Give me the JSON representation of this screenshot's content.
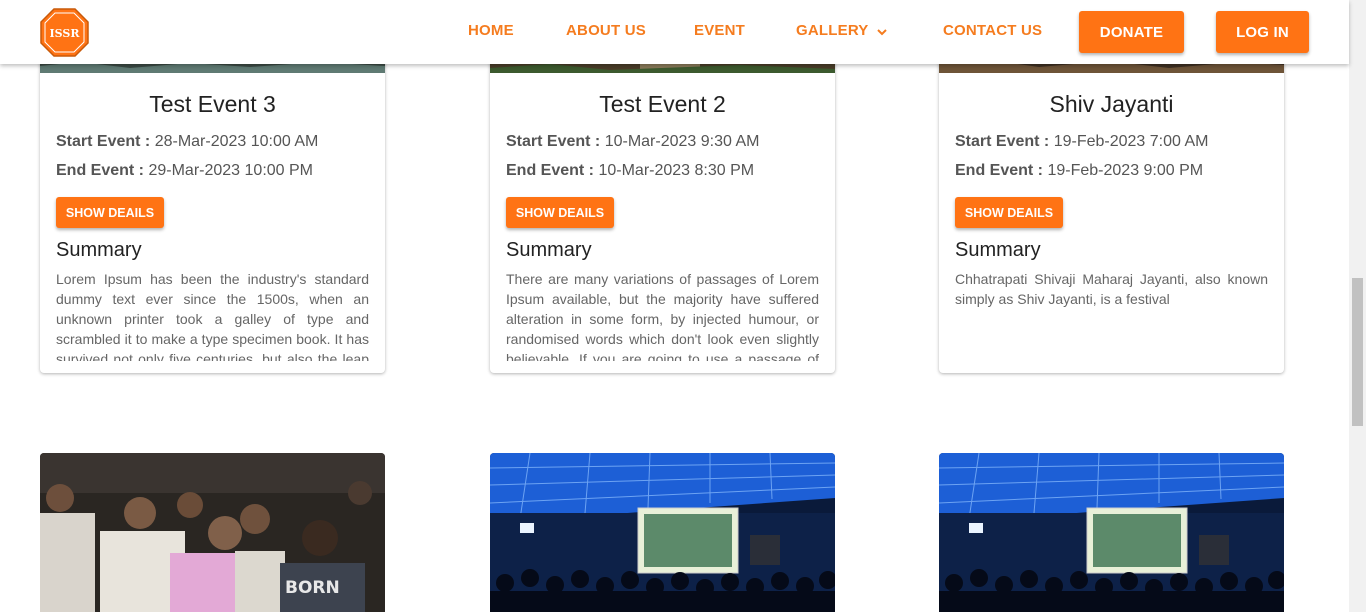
{
  "header": {
    "logo_text": "ISSR",
    "nav": [
      {
        "label": "HOME"
      },
      {
        "label": "ABOUT US"
      },
      {
        "label": "EVENT"
      },
      {
        "label": "GALLERY"
      },
      {
        "label": "CONTACT US"
      }
    ],
    "donate_label": "DONATE",
    "login_label": "LOG IN"
  },
  "colors": {
    "accent": "#ff7314",
    "nav": "#f57c1f"
  },
  "events": [
    {
      "title": "Test Event 3",
      "start_label": "Start Event :",
      "start": "28-Mar-2023 10:00 AM",
      "end_label": "End Event :",
      "end": "29-Mar-2023 10:00 PM",
      "button": "SHOW DEAILS",
      "summary_heading": "Summary",
      "summary": "Lorem Ipsum has been the industry's standard dummy text ever since the 1500s, when an unknown printer took a galley of type and scrambled it to make a type specimen book. It has survived not only five centuries, but also the leap into electronic typesetting"
    },
    {
      "title": "Test Event 2",
      "start_label": "Start Event :",
      "start": "10-Mar-2023 9:30 AM",
      "end_label": "End Event :",
      "end": "10-Mar-2023 8:30 PM",
      "button": "SHOW DEAILS",
      "summary_heading": "Summary",
      "summary": "There are many variations of passages of Lorem Ipsum available, but the majority have suffered alteration in some form, by injected humour, or randomised words which don't look even slightly believable. If you are going to use a passage of Lorem Ipsum"
    },
    {
      "title": "Shiv Jayanti",
      "start_label": "Start Event :",
      "start": "19-Feb-2023 7:00 AM",
      "end_label": "End Event :",
      "end": "19-Feb-2023 9:00 PM",
      "button": "SHOW DEAILS",
      "summary_heading": "Summary",
      "summary": "Chhatrapati Shivaji Maharaj Jayanti, also known simply as Shiv Jayanti, is a festival"
    }
  ],
  "photos": [
    {
      "caption": "BORN"
    },
    {
      "caption": ""
    },
    {
      "caption": ""
    }
  ]
}
